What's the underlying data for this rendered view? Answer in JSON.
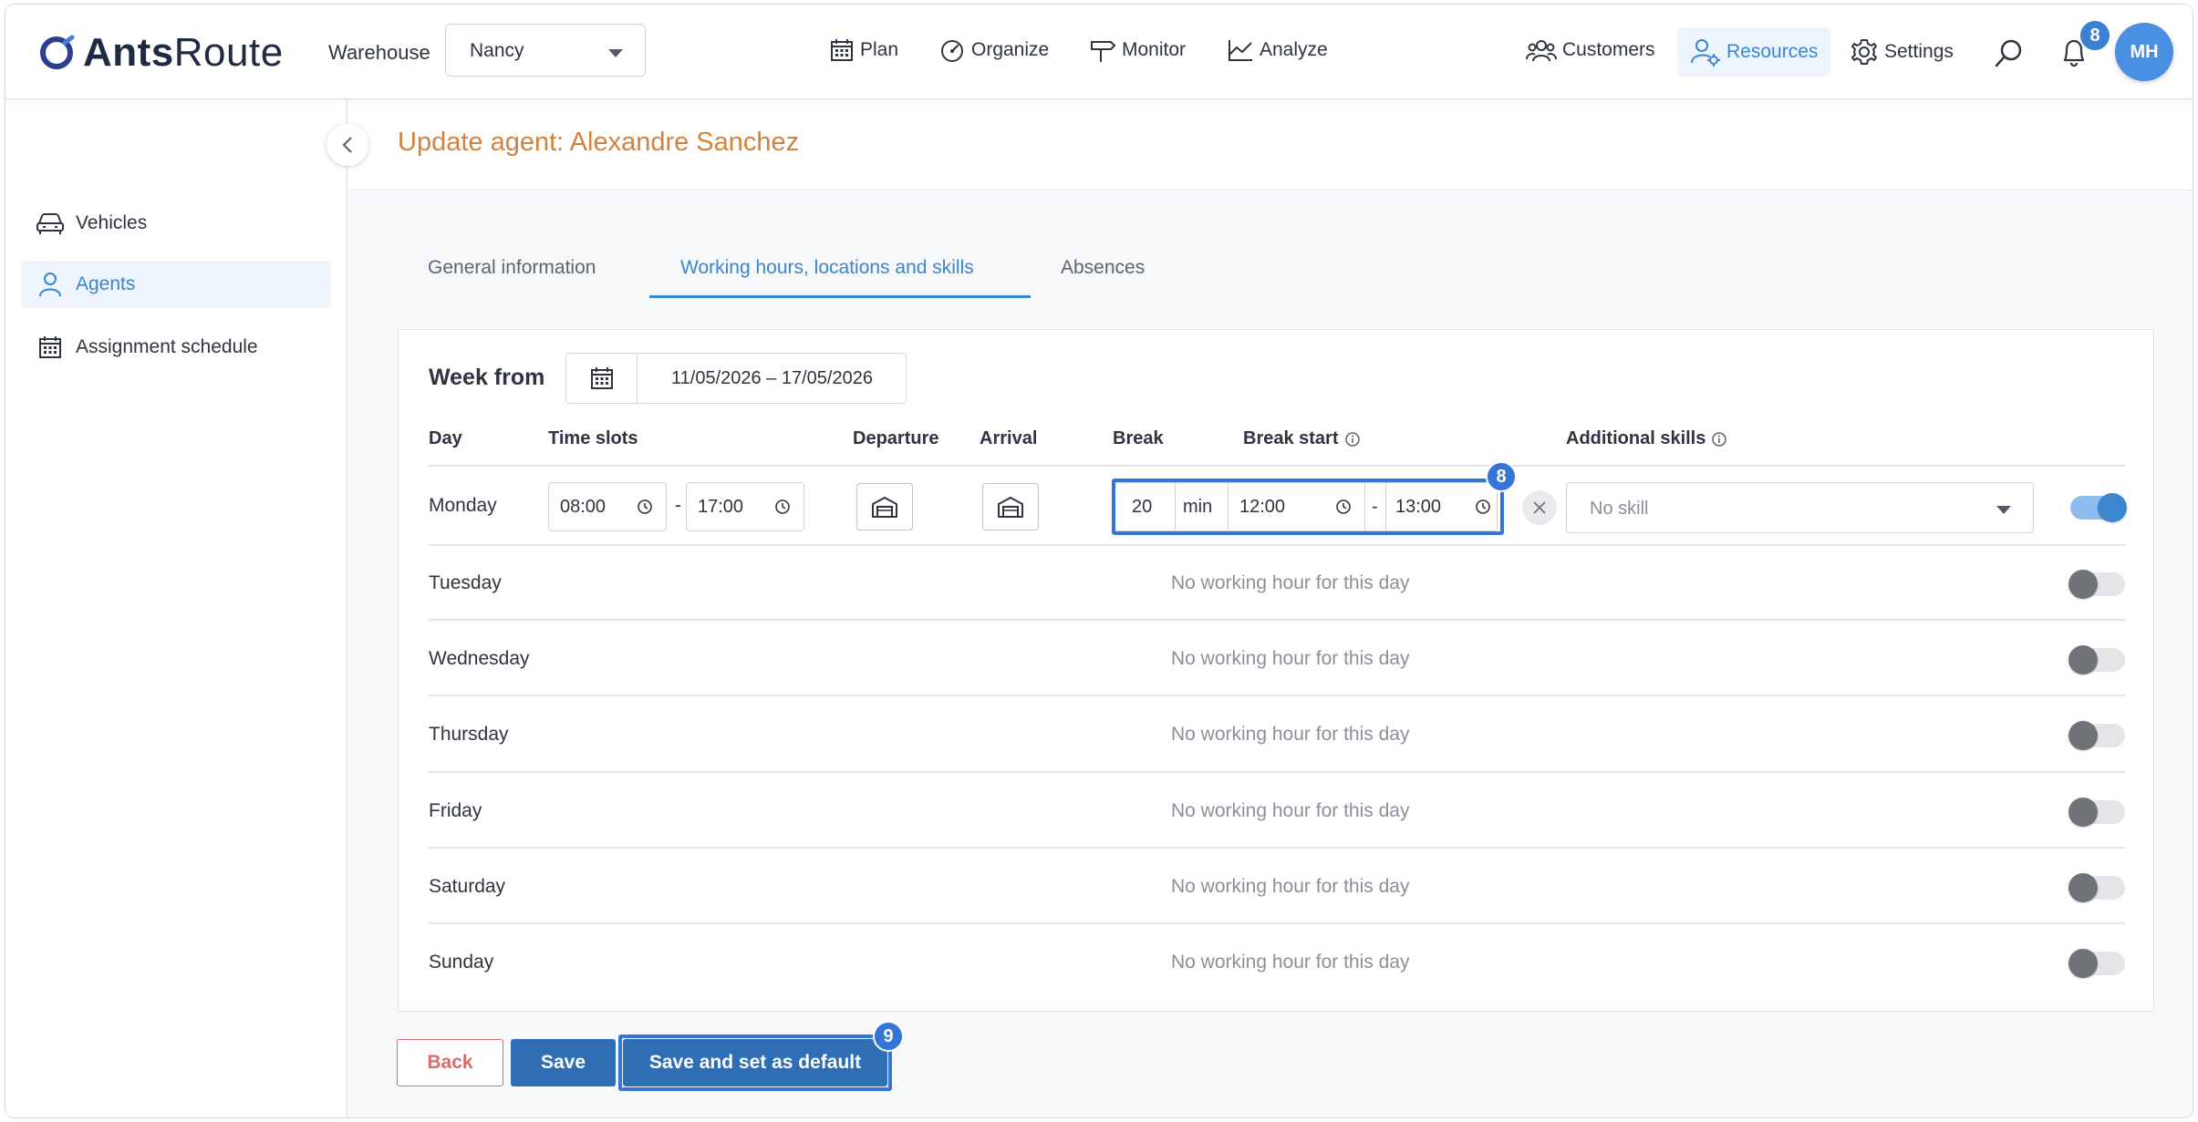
{
  "brand": {
    "name_bold": "Ants",
    "name_light": "Route"
  },
  "header": {
    "warehouse_label": "Warehouse",
    "warehouse_value": "Nancy",
    "nav": [
      {
        "label": "Plan",
        "icon": "calendar-icon"
      },
      {
        "label": "Organize",
        "icon": "gauge-icon"
      },
      {
        "label": "Monitor",
        "icon": "signpost-icon"
      },
      {
        "label": "Analyze",
        "icon": "chart-icon"
      },
      {
        "label": "Customers",
        "icon": "people-icon"
      },
      {
        "label": "Resources",
        "icon": "user-gear-icon",
        "active": true
      },
      {
        "label": "Settings",
        "icon": "gear-icon"
      }
    ],
    "notification_count": "8",
    "avatar_initials": "MH"
  },
  "sidebar": {
    "items": [
      {
        "label": "Vehicles",
        "icon": "car-icon"
      },
      {
        "label": "Agents",
        "icon": "user-icon",
        "active": true
      },
      {
        "label": "Assignment schedule",
        "icon": "calendar-icon"
      }
    ]
  },
  "page": {
    "title": "Update agent: Alexandre Sanchez",
    "tabs": [
      {
        "label": "General information"
      },
      {
        "label": "Working hours, locations and skills",
        "active": true
      },
      {
        "label": "Absences"
      }
    ]
  },
  "schedule": {
    "week_label": "Week from",
    "week_range": "11/05/2026 – 17/05/2026",
    "columns": {
      "day": "Day",
      "time_slots": "Time slots",
      "departure": "Departure",
      "arrival": "Arrival",
      "break": "Break",
      "break_start": "Break start",
      "additional_skills": "Additional skills"
    },
    "monday": {
      "day": "Monday",
      "start": "08:00",
      "end": "17:00",
      "dash": "-",
      "break_minutes": "20",
      "break_unit": "min",
      "break_from": "12:00",
      "break_to": "13:00",
      "skill_placeholder": "No skill",
      "enabled": true
    },
    "other_days": [
      {
        "day": "Tuesday",
        "note": "No working hour for this day"
      },
      {
        "day": "Wednesday",
        "note": "No working hour for this day"
      },
      {
        "day": "Thursday",
        "note": "No working hour for this day"
      },
      {
        "day": "Friday",
        "note": "No working hour for this day"
      },
      {
        "day": "Saturday",
        "note": "No working hour for this day"
      },
      {
        "day": "Sunday",
        "note": "No working hour for this day"
      }
    ]
  },
  "actions": {
    "back": "Back",
    "save": "Save",
    "save_default": "Save and set as default"
  },
  "step_badges": {
    "break_step": "8",
    "save_default_step": "9"
  },
  "colors": {
    "accent": "#3a86cf",
    "title": "#d2823c",
    "primary_button": "#2f6db5",
    "highlight": "#3575d8"
  }
}
